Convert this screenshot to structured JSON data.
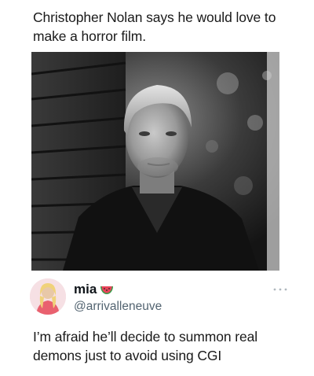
{
  "post": {
    "headline": "Christopher Nolan says he would love to make a horror film."
  },
  "tweet": {
    "display_name": "mia",
    "handle": "@arrivalleneuve",
    "text": "I’m afraid he’ll decide to summon real demons just to avoid using CGI",
    "name_emoji": "watermelon-icon",
    "more_icon": "more-dots-icon"
  },
  "colors": {
    "text_primary": "#0f1419",
    "text_secondary": "#536471",
    "watermelon_red": "#e8455a",
    "watermelon_green": "#3b9c4a"
  }
}
